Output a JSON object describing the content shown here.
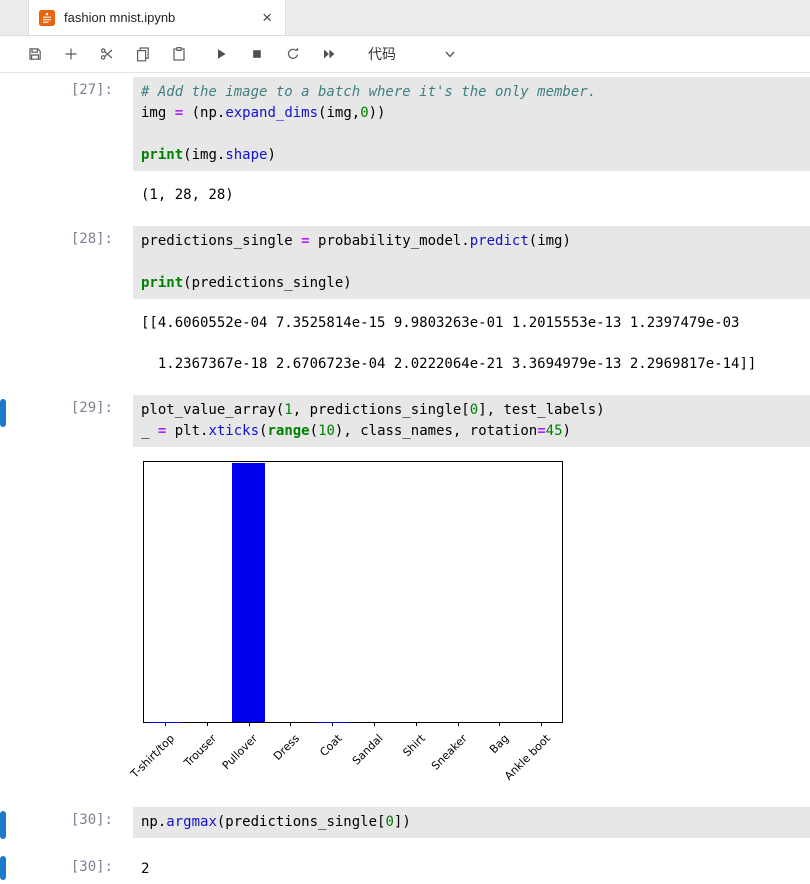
{
  "colors": {
    "accent": "#1f78c8",
    "code_cell_bg": "#e7e7e7"
  },
  "tab": {
    "title": "fashion mnist.ipynb",
    "close_glyph": "×",
    "icon": "notebook-icon"
  },
  "toolbar": {
    "icons": [
      "save",
      "add-cell",
      "cut",
      "copy",
      "paste",
      "run",
      "stop",
      "restart",
      "run-all"
    ],
    "celltype_label": "代码"
  },
  "cells": [
    {
      "exec": "[27]:",
      "active": false,
      "code": [
        [
          {
            "c": "cm",
            "t": "# Add the image to a batch where it's the only member."
          }
        ],
        [
          {
            "c": "p",
            "t": "img "
          },
          {
            "c": "k",
            "t": "="
          },
          {
            "c": "p",
            "t": " (np."
          },
          {
            "c": "f",
            "t": "expand_dims"
          },
          {
            "c": "p",
            "t": "(img,"
          },
          {
            "c": "n",
            "t": "0"
          },
          {
            "c": "p",
            "t": "))"
          }
        ],
        [],
        [
          {
            "c": "b",
            "t": "print"
          },
          {
            "c": "p",
            "t": "(img."
          },
          {
            "c": "f",
            "t": "shape"
          },
          {
            "c": "p",
            "t": ")"
          }
        ]
      ],
      "outputs": [
        {
          "type": "text",
          "lines": [
            "(1, 28, 28)"
          ]
        }
      ]
    },
    {
      "exec": "[28]:",
      "active": false,
      "code": [
        [
          {
            "c": "p",
            "t": "predictions_single "
          },
          {
            "c": "k",
            "t": "="
          },
          {
            "c": "p",
            "t": " probability_model."
          },
          {
            "c": "f",
            "t": "predict"
          },
          {
            "c": "p",
            "t": "(img)"
          }
        ],
        [],
        [
          {
            "c": "b",
            "t": "print"
          },
          {
            "c": "p",
            "t": "(predictions_single)"
          }
        ]
      ],
      "outputs": [
        {
          "type": "text",
          "spread": true,
          "lines": [
            "[[4.6060552e-04 7.3525814e-15 9.9803263e-01 1.2015553e-13 1.2397479e-03",
            "  1.2367367e-18 2.6706723e-04 2.0222064e-21 3.3694979e-13 2.2969817e-14]]"
          ]
        }
      ]
    },
    {
      "exec": "[29]:",
      "active": true,
      "code": [
        [
          {
            "c": "p",
            "t": "plot_value_array("
          },
          {
            "c": "n",
            "t": "1"
          },
          {
            "c": "p",
            "t": ", predictions_single["
          },
          {
            "c": "n",
            "t": "0"
          },
          {
            "c": "p",
            "t": "], test_labels)"
          }
        ],
        [
          {
            "c": "p",
            "t": "_ "
          },
          {
            "c": "k",
            "t": "="
          },
          {
            "c": "p",
            "t": " plt."
          },
          {
            "c": "f",
            "t": "xticks"
          },
          {
            "c": "p",
            "t": "("
          },
          {
            "c": "b",
            "t": "range"
          },
          {
            "c": "p",
            "t": "("
          },
          {
            "c": "n",
            "t": "10"
          },
          {
            "c": "p",
            "t": "), class_names, rotation"
          },
          {
            "c": "k",
            "t": "="
          },
          {
            "c": "n",
            "t": "45"
          },
          {
            "c": "p",
            "t": ")"
          }
        ]
      ],
      "outputs": [
        {
          "type": "chart"
        }
      ]
    },
    {
      "exec": "[30]:",
      "active": true,
      "code": [
        [
          {
            "c": "p",
            "t": "np."
          },
          {
            "c": "f",
            "t": "argmax"
          },
          {
            "c": "p",
            "t": "(predictions_single["
          },
          {
            "c": "n",
            "t": "0"
          },
          {
            "c": "p",
            "t": "])"
          }
        ]
      ],
      "outputs": []
    },
    {
      "exec": "[30]:",
      "active": true,
      "result": "2"
    }
  ],
  "chart_data": {
    "type": "bar",
    "categories": [
      "T-shirt/top",
      "Trouser",
      "Pullover",
      "Dress",
      "Coat",
      "Sandal",
      "Shirt",
      "Sneaker",
      "Bag",
      "Ankle boot"
    ],
    "values": [
      0.00046060552,
      7.3525814e-15,
      0.99803263,
      1.2015553e-13,
      0.0012397479,
      1.2367367e-18,
      0.00026706723,
      2.0222064e-21,
      3.3694979e-13,
      2.2969817e-14
    ],
    "title": "",
    "xlabel": "",
    "ylabel": "",
    "ylim": [
      0,
      1
    ],
    "grid": false,
    "legend": "none",
    "xtick_rotation": 45,
    "bar_color": "#0000f0",
    "highlight_index": 2
  }
}
